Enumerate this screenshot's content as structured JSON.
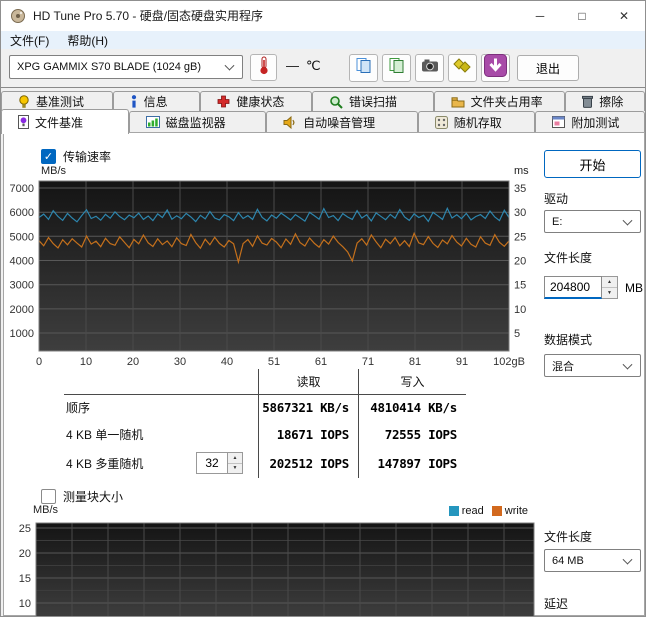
{
  "window": {
    "title": "HD Tune Pro 5.70 - 硬盘/固态硬盘实用程序",
    "minimize": "─",
    "maximize": "□",
    "close": "✕"
  },
  "menu": {
    "items": [
      "文件(F)",
      "帮助(H)"
    ]
  },
  "toolbar": {
    "device_select": {
      "value": "XPG GAMMIX S70 BLADE (1024 gB)"
    },
    "temperature": {
      "value": "—",
      "unit": "℃"
    },
    "exit_label": "退出",
    "icons": [
      "thermometer-icon",
      "copy-text-icon",
      "copy-image-icon",
      "screenshot-camera-icon",
      "save-yellow-icon",
      "download-purple-icon"
    ]
  },
  "tabs": {
    "row1": [
      {
        "label": "基准测试",
        "icon": "benchmark-icon"
      },
      {
        "label": "信息",
        "icon": "info-icon"
      },
      {
        "label": "健康状态",
        "icon": "health-icon"
      },
      {
        "label": "错误扫描",
        "icon": "error-scan-icon"
      },
      {
        "label": "文件夹占用率",
        "icon": "folder-usage-icon"
      },
      {
        "label": "擦除",
        "icon": "erase-icon"
      }
    ],
    "row2": [
      {
        "label": "文件基准",
        "icon": "file-benchmark-icon",
        "active": true
      },
      {
        "label": "磁盘监视器",
        "icon": "disk-monitor-icon"
      },
      {
        "label": "自动噪音管理",
        "icon": "aam-icon"
      },
      {
        "label": "随机存取",
        "icon": "random-access-icon"
      },
      {
        "label": "附加测试",
        "icon": "extra-tests-icon"
      }
    ]
  },
  "file_benchmark": {
    "transfer_rate_checkbox": {
      "label": "传输速率",
      "checked": true
    },
    "start_button": "开始",
    "drive": {
      "label": "驱动",
      "value": "E:"
    },
    "file_length": {
      "label": "文件长度",
      "value": "204800",
      "unit": "MB"
    },
    "data_pattern": {
      "label": "数据模式",
      "value": "混合"
    },
    "results_table": {
      "read_header": "读取",
      "write_header": "写入",
      "rows": [
        {
          "label": "顺序",
          "read": "5867321 KB/s",
          "write": "4810414 KB/s"
        },
        {
          "label": "4 KB 单一随机",
          "read": "18671 IOPS",
          "write": "72555 IOPS"
        },
        {
          "label": "4 KB 多重随机",
          "queue_depth": "32",
          "read": "202512 IOPS",
          "write": "147897 IOPS"
        }
      ]
    },
    "block_size_checkbox": {
      "label": "测量块大小",
      "checked": false
    },
    "bottom_file_length": {
      "label": "文件长度",
      "value": "64 MB"
    },
    "latency_label": "延迟"
  },
  "chart_data": [
    {
      "type": "line",
      "name": "transfer-rate",
      "y_left_label": "MB/s",
      "y_right_label": "ms",
      "y_left_ticks": [
        7000,
        6000,
        5000,
        4000,
        3000,
        2000,
        1000
      ],
      "y_right_ticks": [
        35,
        30,
        25,
        20,
        15,
        10,
        5
      ],
      "x_ticks": [
        "0",
        "10",
        "20",
        "30",
        "40",
        "51",
        "61",
        "71",
        "81",
        "91",
        "102gB"
      ],
      "x_range_gb": [
        0,
        102
      ],
      "grid": true,
      "legend_position": "none",
      "series": [
        {
          "name": "read",
          "unit": "MB/s",
          "color": "#2d86ae",
          "values": [
            5780,
            5920,
            5700,
            6060,
            5820,
            5660,
            5950,
            5760,
            5600,
            5860,
            6100,
            5740,
            5830,
            5670,
            5910,
            5750,
            6010,
            5820,
            5690,
            5880,
            5770,
            5960,
            5700,
            5840,
            5650,
            5930,
            5780,
            6090,
            5710,
            5850,
            5730,
            5950,
            5800,
            5610,
            5870,
            5720,
            6030,
            5760,
            5680,
            5900,
            5810,
            5650,
            5980,
            5740,
            5860,
            5700,
            6120,
            5790,
            5640,
            5880,
            5750,
            5960,
            5820,
            5680,
            5900,
            5770,
            5630,
            5990,
            5850,
            5710,
            6150,
            5780,
            5860,
            5650,
            5940,
            5800,
            5700,
            6060,
            5760,
            5890,
            5640,
            5970,
            5830,
            5690,
            5910,
            5750,
            6110,
            5800,
            5660,
            5930,
            5780,
            5870,
            5620,
            5990,
            5850,
            5700,
            6160,
            5760,
            5890,
            5730,
            5950,
            5680,
            5820,
            5900,
            5740,
            6050,
            5800,
            5650,
            6080,
            5780
          ]
        },
        {
          "name": "write",
          "unit": "MB/s",
          "color": "#c4701c",
          "values": [
            4820,
            4610,
            4950,
            4700,
            4520,
            4860,
            4650,
            4900,
            4720,
            4560,
            5010,
            4680,
            4800,
            4570,
            4920,
            4700,
            4630,
            4980,
            4750,
            4530,
            4870,
            4690,
            5050,
            4730,
            4580,
            4900,
            4660,
            4810,
            4570,
            4940,
            4700,
            4620,
            5080,
            4740,
            4510,
            4880,
            4650,
            4960,
            4710,
            4560,
            4830,
            4690,
            3940,
            4700,
            4870,
            4590,
            5020,
            4720,
            4640,
            4910,
            4760,
            4530,
            4890,
            4670,
            5100,
            4740,
            4600,
            4930,
            4710,
            4550,
            4860,
            4680,
            5010,
            4750,
            4570,
            4360,
            3980,
            4720,
            4900,
            4640,
            5060,
            4770,
            4530,
            4880,
            4700,
            4950,
            4610,
            4820,
            4580,
            5120,
            4730,
            4660,
            4990,
            4710,
            4540,
            4850,
            4690,
            5030,
            4760,
            4600,
            4920,
            4670,
            4560,
            4980,
            4720,
            4630,
            5070,
            4750,
            4590,
            4810
          ]
        }
      ]
    },
    {
      "type": "line",
      "name": "block-size",
      "y_left_label": "MB/s",
      "y_left_ticks": [
        25,
        20,
        15,
        10
      ],
      "legend_position": "top-right",
      "legend": [
        {
          "name": "read",
          "color": "#2596be"
        },
        {
          "name": "write",
          "color": "#d2691e"
        }
      ],
      "series": []
    }
  ]
}
